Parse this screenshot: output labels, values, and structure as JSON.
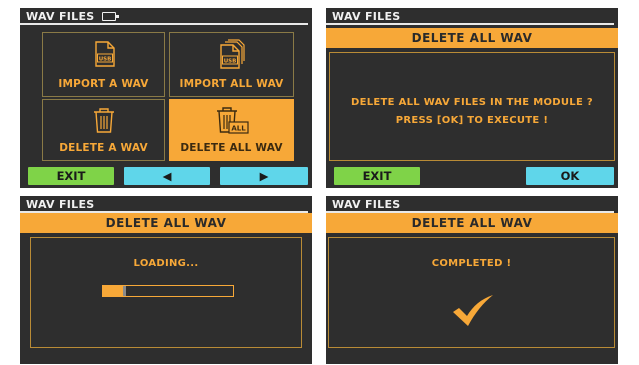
{
  "screen1": {
    "title": "WAV FILES",
    "tiles": [
      {
        "label": "IMPORT A WAV",
        "icon_text": "USB"
      },
      {
        "label": "IMPORT ALL WAV",
        "icon_text": "USB"
      },
      {
        "label": "DELETE A WAV",
        "icon_text": ""
      },
      {
        "label": "DELETE ALL WAV",
        "icon_text": "ALL"
      }
    ],
    "buttons": {
      "exit": "EXIT",
      "left": "◀",
      "right": "▶"
    }
  },
  "screen2": {
    "title": "WAV FILES",
    "banner": "DELETE ALL WAV",
    "message_line1": "DELETE ALL WAV FILES IN THE MODULE ?",
    "message_line2": "PRESS [OK] TO EXECUTE !",
    "buttons": {
      "exit": "EXIT",
      "ok": "OK"
    }
  },
  "screen3": {
    "title": "WAV FILES",
    "banner": "DELETE ALL WAV",
    "status": "LOADING...",
    "progress": 0.15
  },
  "screen4": {
    "title": "WAV FILES",
    "banner": "DELETE ALL WAV",
    "status": "COMPLETED !"
  },
  "colors": {
    "accent": "#f7a838",
    "panel_bg": "#2e2e2e",
    "button_green": "#7fd348",
    "button_cyan": "#5fd6ea"
  }
}
